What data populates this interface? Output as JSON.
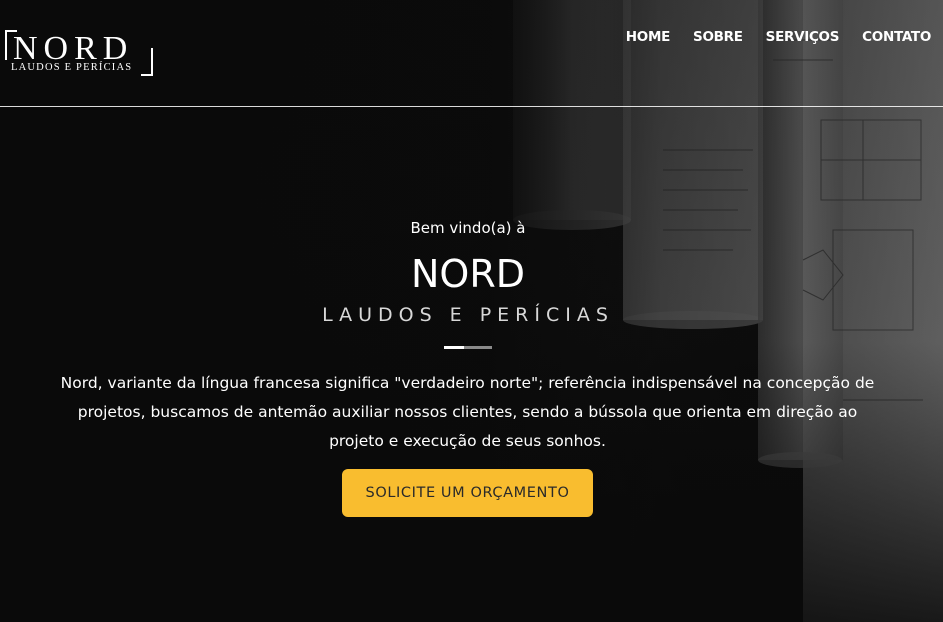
{
  "header": {
    "logo": {
      "main": "NORD",
      "sub": "LAUDOS E PERÍCIAS"
    },
    "nav": [
      {
        "label": "HOME"
      },
      {
        "label": "SOBRE"
      },
      {
        "label": "SERVIÇOS"
      },
      {
        "label": "CONTATO"
      }
    ]
  },
  "hero": {
    "welcome": "Bem vindo(a) à",
    "title": "NORD",
    "subtitle": "LAUDOS E PERÍCIAS",
    "description": "Nord, variante da língua francesa significa \"verdadeiro norte\"; referência indispensável na concepção de projetos, buscamos de antemão auxiliar nossos clientes, sendo a bússola que orienta em direção ao projeto e execução de seus sonhos.",
    "cta_label": "SOLICITE UM ORÇAMENTO"
  },
  "colors": {
    "background": "#0b0b0b",
    "text": "#ffffff",
    "accent": "#f9bd2f",
    "cta_text": "#2a2a2a"
  },
  "icons": {
    "background_image": "architectural-blueprints-illustration"
  }
}
